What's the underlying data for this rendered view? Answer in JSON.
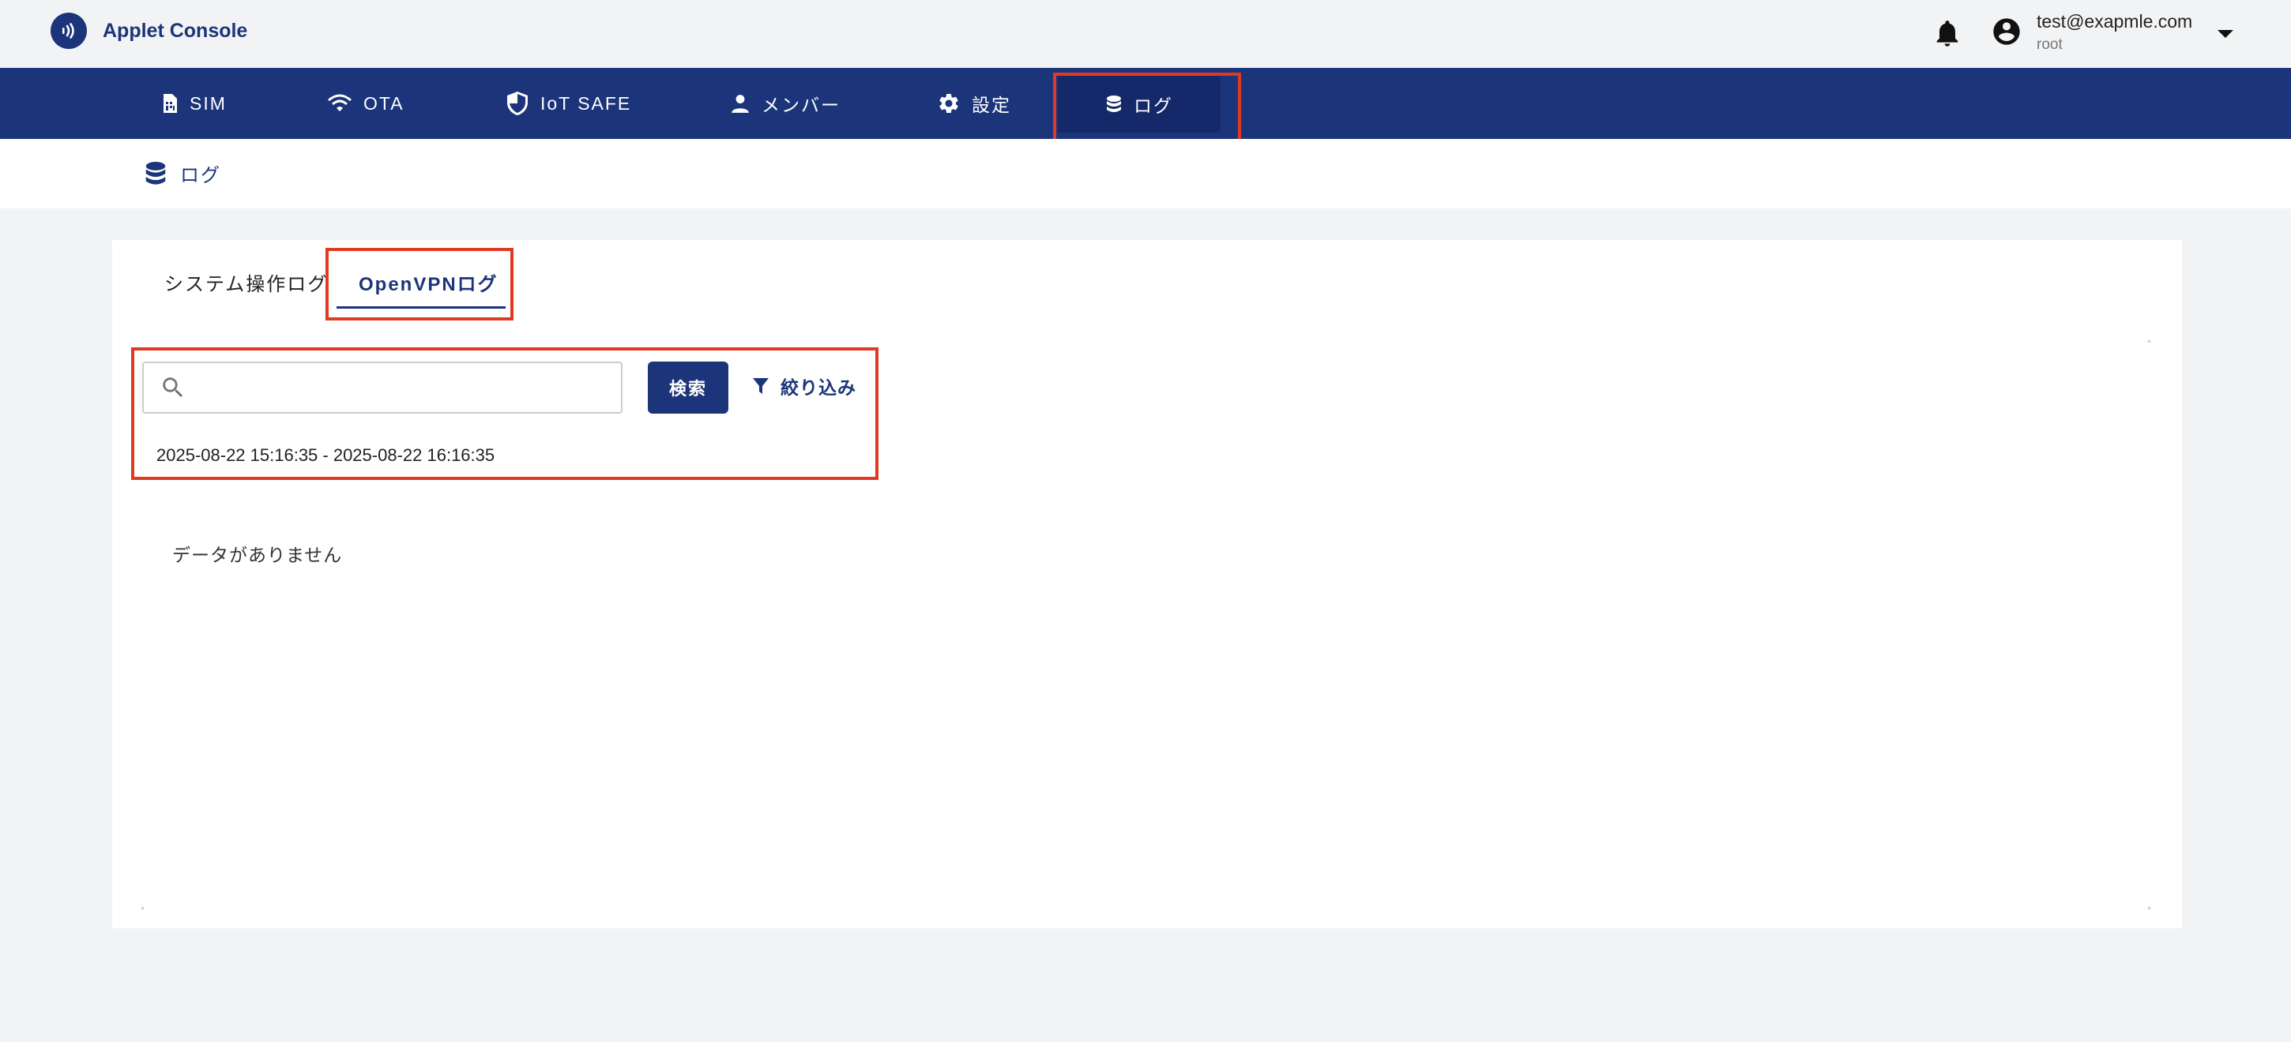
{
  "app": {
    "title": "Applet Console"
  },
  "user": {
    "email": "test@exapmle.com",
    "role": "root"
  },
  "nav": {
    "items": [
      {
        "label": "SIM",
        "icon": "sim-card-icon"
      },
      {
        "label": "OTA",
        "icon": "wifi-icon"
      },
      {
        "label": "IoT SAFE",
        "icon": "shield-icon"
      },
      {
        "label": "メンバー",
        "icon": "person-icon"
      },
      {
        "label": "設定",
        "icon": "gear-icon"
      },
      {
        "label": "ログ",
        "icon": "database-icon",
        "active": true
      }
    ]
  },
  "breadcrumb": {
    "label": "ログ",
    "icon": "database-icon"
  },
  "tabs": [
    {
      "label": "システム操作ログ",
      "active": false
    },
    {
      "label": "OpenVPNログ",
      "active": true
    }
  ],
  "search": {
    "value": "",
    "placeholder": "",
    "button_label": "検索",
    "filter_label": "絞り込み"
  },
  "date_range": "2025-08-22 15:16:35 - 2025-08-22 16:16:35",
  "empty_message": "データがありません",
  "colors": {
    "primary": "#1c357a",
    "highlight": "#e03a22",
    "background": "#f2f3f5"
  }
}
